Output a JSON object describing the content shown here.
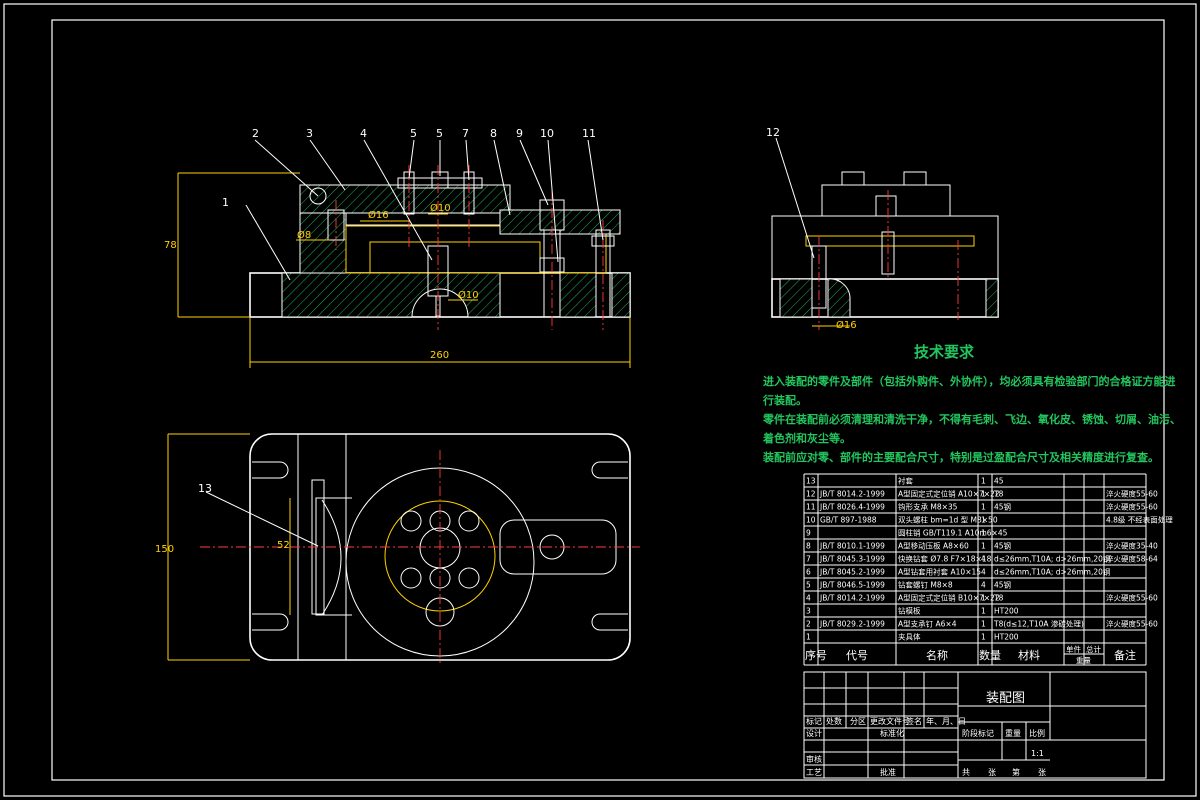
{
  "balloons": [
    "1",
    "2",
    "3",
    "4",
    "5",
    "5",
    "6",
    "7",
    "8",
    "9",
    "10",
    "11",
    "12",
    "13"
  ],
  "dimensions": {
    "front_height": "78",
    "front_width": "260",
    "front_d1": "Ø16",
    "front_d2": "Ø10",
    "front_d3": "Ø8",
    "front_d4": "Ø10",
    "side_d": "Ø16",
    "plan_height": "150",
    "plan_inner": "52"
  },
  "tech": {
    "title": "技术要求",
    "lines": [
      "进入装配的零件及部件（包括外购件、外协件），均必须具有检验部门的合格证方能进",
      "行装配。",
      "零件在装配前必须清理和清洗干净，不得有毛刺、飞边、氧化皮、锈蚀、切屑、油污、",
      "着色剂和灰尘等。",
      "装配前应对零、部件的主要配合尺寸，特别是过盈配合尺寸及相关精度进行复查。"
    ]
  },
  "bom": {
    "rows": [
      {
        "no": "13",
        "code": "",
        "name": "衬套",
        "qty": "1",
        "mat": "45",
        "note": ""
      },
      {
        "no": "12",
        "code": "JB/T 8014.2-1999",
        "name": "A型固定式定位销 A10×7×22",
        "qty": "1",
        "mat": "T8",
        "note": "淬火硬度55-60"
      },
      {
        "no": "11",
        "code": "JB/T 8026.4-1999",
        "name": "钩形支承 M8×35",
        "qty": "1",
        "mat": "45钢",
        "note": "淬火硬度55-60"
      },
      {
        "no": "10",
        "code": "GB/T 897-1988",
        "name": "双头螺柱 bm=1d 型 M8×50",
        "qty": "1",
        "mat": "",
        "note": "4.8级 不经表面处理"
      },
      {
        "no": "9",
        "code": "",
        "name": "圆柱销 GB/T119.1 A10m6×45",
        "qty": "1",
        "mat": "",
        "note": ""
      },
      {
        "no": "8",
        "code": "JB/T 8010.1-1999",
        "name": "A型移动压板 A8×60",
        "qty": "1",
        "mat": "45钢",
        "note": "淬火硬度35-40"
      },
      {
        "no": "7",
        "code": "JB/T 8045.3-1999",
        "name": "快换钻套 Ø7.8 F7×18×18",
        "qty": "4",
        "mat": "d≤26mm,T10A; d>26mm,20钢",
        "note": "淬火硬度58-64"
      },
      {
        "no": "6",
        "code": "JB/T 8045.2-1999",
        "name": "A型钻套用衬套 A10×15",
        "qty": "4",
        "mat": "d≤26mm,T10A; d>26mm,20钢",
        "note": ""
      },
      {
        "no": "5",
        "code": "JB/T 8046.5-1999",
        "name": "钻套螺钉 M8×8",
        "qty": "4",
        "mat": "45钢",
        "note": ""
      },
      {
        "no": "4",
        "code": "JB/T 8014.2-1999",
        "name": "A型固定式定位销 B10×7×22",
        "qty": "1",
        "mat": "T8",
        "note": "淬火硬度55-60"
      },
      {
        "no": "3",
        "code": "",
        "name": "钻模板",
        "qty": "1",
        "mat": "HT200",
        "note": ""
      },
      {
        "no": "2",
        "code": "JB/T 8029.2-1999",
        "name": "A型支承钉 A6×4",
        "qty": "1",
        "mat": "T8(d≤12,T10A 渗碳处理)",
        "note": "淬火硬度55-60"
      },
      {
        "no": "1",
        "code": "",
        "name": "夹具体",
        "qty": "1",
        "mat": "HT200",
        "note": ""
      }
    ],
    "header": {
      "no": "序号",
      "code": "代号",
      "name": "名称",
      "qty": "数量",
      "mat": "材料",
      "unit": "单件",
      "total": "总计",
      "weight": "重量",
      "note": "备注"
    }
  },
  "titleblock": {
    "drawing_name": "装配图",
    "mark": "标记",
    "count": "处数",
    "zone": "分区",
    "doc": "更改文件号",
    "sign": "签名",
    "date": "年、月、日",
    "design": "设计",
    "std": "标准化",
    "check": "审核",
    "process": "工艺",
    "approve": "批准",
    "stage": "阶段标记",
    "weight": "重量",
    "scale": "比例",
    "scale_value": "1:1",
    "total": "共",
    "sheet_of": "张",
    "page": "第",
    "page_of": "张"
  },
  "colors": {
    "background": "#000000",
    "outline": "#ffffff",
    "dimension": "#ffd200",
    "text_green": "#22c55e",
    "centerline": "#ff3b3b",
    "cyan": "#22d3ee",
    "magenta": "#e040fb"
  }
}
